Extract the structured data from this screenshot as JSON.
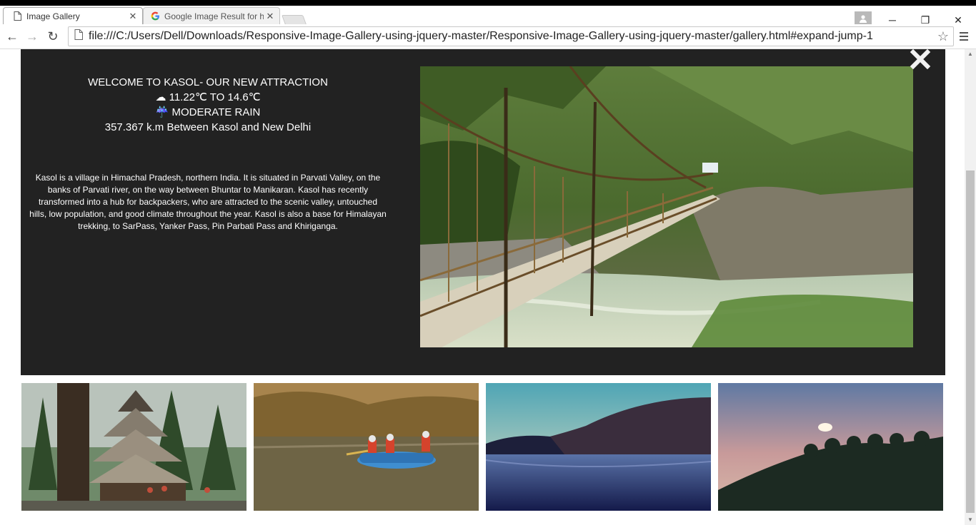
{
  "browser": {
    "tabs": [
      {
        "title": "Image Gallery",
        "close": "✕"
      },
      {
        "title": "Google Image Result for h",
        "close": "✕"
      }
    ],
    "url": "file:///C:/Users/Dell/Downloads/Responsive-Image-Gallery-using-jquery-master/Responsive-Image-Gallery-using-jquery-master/gallery.html#expand-jump-1",
    "window_controls": {
      "minimize": "─",
      "maximize": "❐",
      "close": "✕"
    },
    "nav": {
      "back": "←",
      "forward": "→",
      "reload": "↻",
      "bookmark": "☆"
    }
  },
  "expanded": {
    "title": "WELCOME TO KASOL- OUR NEW ATTRACTION",
    "temperature": "☁ 11.22℃ TO 14.6℃",
    "weather": "☔ MODERATE RAIN",
    "distance": "357.367 k.m Between Kasol and New Delhi",
    "description": "Kasol is a village in Himachal Pradesh, northern India. It is situated in Parvati Valley, on the banks of Parvati river, on the way between Bhuntar to Manikaran. Kasol has recently transformed into a hub for backpackers, who are attracted to the scenic valley, untouched hills, low population, and good climate throughout the year. Kasol is also a base for Himalayan trekking, to SarPass, Yanker Pass, Pin Parbati Pass and Khiriganga.",
    "close_icon": "close-x-icon"
  },
  "thumbnails": [
    {
      "subject": "temple-in-forest"
    },
    {
      "subject": "river-rafting"
    },
    {
      "subject": "lake-at-dusk"
    },
    {
      "subject": "sunset-hills"
    }
  ],
  "colors": {
    "panel_bg": "#222222",
    "panel_text": "#ffffff",
    "scroll_thumb": "#c1c1c1"
  }
}
